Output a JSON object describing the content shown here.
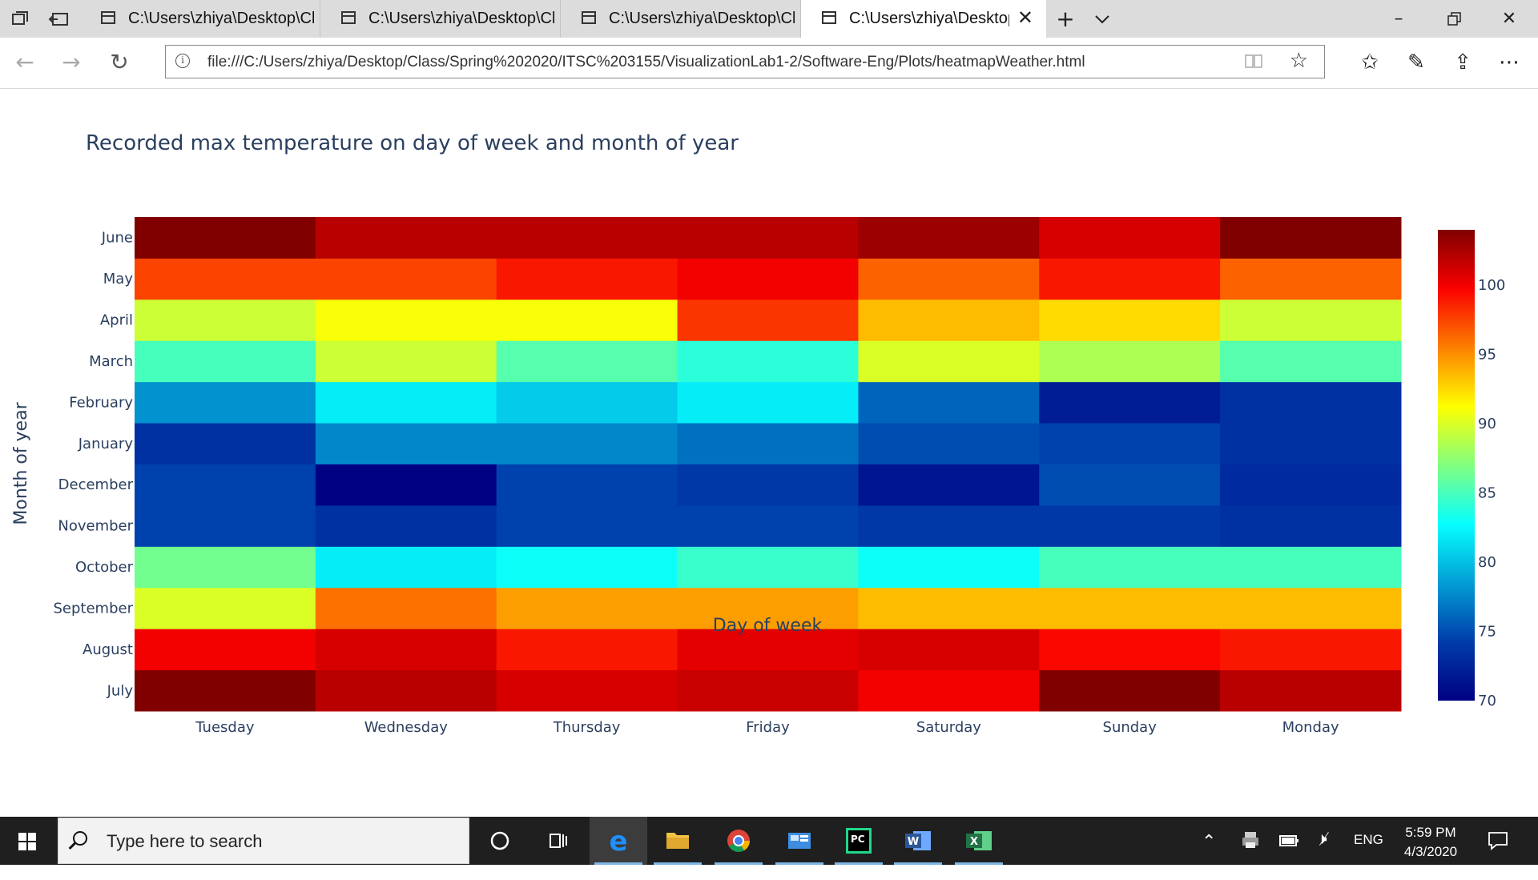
{
  "browser": {
    "tabs": [
      {
        "title": "C:\\Users\\zhiya\\Desktop\\Cla:",
        "active": false
      },
      {
        "title": "C:\\Users\\zhiya\\Desktop\\Cla",
        "active": false
      },
      {
        "title": "C:\\Users\\zhiya\\Desktop\\Cla:",
        "active": false
      },
      {
        "title": "C:\\Users\\zhiya\\Desktop'",
        "active": true
      }
    ],
    "url": "file:///C:/Users/zhiya/Desktop/Class/Spring%202020/ITSC%203155/VisualizationLab1-2/Software-Eng/Plots/heatmapWeather.html"
  },
  "chart_data": {
    "type": "heatmap",
    "title": "Recorded max temperature on day of week and month of year",
    "xlabel": "Day of week",
    "ylabel": "Month of year",
    "colorscale": "jet",
    "zlim": [
      70,
      104
    ],
    "colorbar_ticks": [
      70,
      75,
      80,
      85,
      90,
      95,
      100
    ],
    "x": [
      "Tuesday",
      "Wednesday",
      "Thursday",
      "Friday",
      "Saturday",
      "Sunday",
      "Monday"
    ],
    "y": [
      "July",
      "August",
      "September",
      "October",
      "November",
      "December",
      "January",
      "February",
      "March",
      "April",
      "May",
      "June"
    ],
    "z": [
      [
        104,
        102,
        101,
        101.5,
        100,
        104,
        102
      ],
      [
        100,
        101,
        99,
        100.5,
        101,
        99.5,
        99
      ],
      [
        90,
        96,
        94.5,
        94.5,
        93.5,
        93.5,
        93.5
      ],
      [
        86.5,
        82,
        83,
        84.5,
        83,
        85,
        85
      ],
      [
        74.5,
        73.5,
        74.5,
        74.5,
        74,
        74,
        73.5
      ],
      [
        74.5,
        70,
        74.5,
        74,
        71.5,
        75,
        73
      ],
      [
        73.5,
        77.5,
        77.5,
        76.5,
        75,
        74.5,
        73.5
      ],
      [
        78,
        82,
        80.5,
        82,
        76,
        72,
        73.5
      ],
      [
        85,
        89.5,
        85.5,
        84,
        90,
        88.5,
        85.5
      ],
      [
        89.5,
        91,
        91,
        98,
        93.5,
        92.5,
        89.5
      ],
      [
        97.5,
        97.5,
        99,
        100,
        96.5,
        99,
        96.5
      ],
      [
        104,
        102,
        102,
        102,
        103,
        101,
        104
      ]
    ]
  },
  "taskbar": {
    "search_placeholder": "Type here to search",
    "language": "ENG",
    "time": "5:59 PM",
    "date": "4/3/2020"
  }
}
